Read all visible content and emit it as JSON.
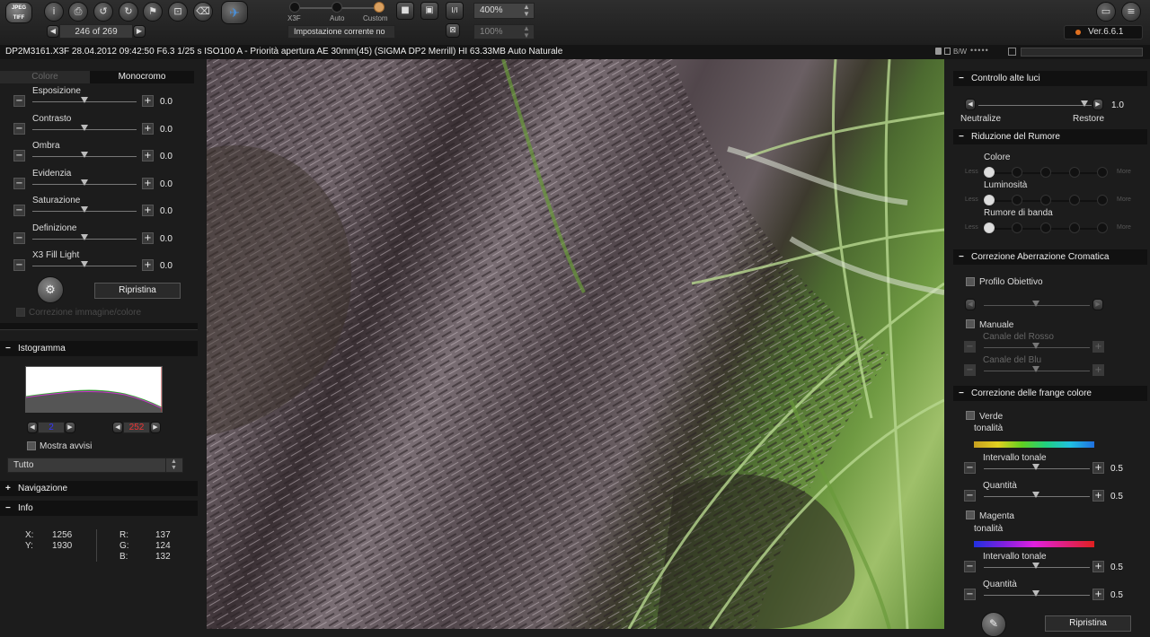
{
  "toolbar": {
    "file_format_icon_text": "JPEG TIFF",
    "nav_counter": "246 of 269",
    "mode_labels": [
      "X3F",
      "Auto",
      "Custom"
    ],
    "current_setting": "Impostazione corrente no",
    "zoom_primary": "400%",
    "zoom_secondary": "100%",
    "version": "Ver.6.6.1"
  },
  "infobar": {
    "text": "DP2M3161.X3F  28.04.2012 09:42:50  F6.3 1/25 s ISO100 A - Priorità apertura AE 30mm(45) (SIGMA DP2 Merrill) HI 63.33MB Auto Naturale",
    "bw_label": "B/W"
  },
  "left_panel": {
    "tabs": [
      "Colore",
      "Monocromo"
    ],
    "sliders": [
      {
        "label": "Esposizione",
        "value": "0.0"
      },
      {
        "label": "Contrasto",
        "value": "0.0"
      },
      {
        "label": "Ombra",
        "value": "0.0"
      },
      {
        "label": "Evidenzia",
        "value": "0.0"
      },
      {
        "label": "Saturazione",
        "value": "0.0"
      },
      {
        "label": "Definizione",
        "value": "0.0"
      },
      {
        "label": "X3 Fill Light",
        "value": "0.0"
      }
    ],
    "reset_label": "Ripristina",
    "faded_option": "Correzione immagine/colore",
    "histogram": {
      "title": "Istogramma",
      "low_value": "2",
      "high_value": "252",
      "warnings_label": "Mostra avvisi",
      "channel": "Tutto"
    },
    "navigation_title": "Navigazione",
    "info": {
      "title": "Info",
      "x_label": "X:",
      "x": "1256",
      "y_label": "Y:",
      "y": "1930",
      "r_label": "R:",
      "r": "137",
      "g_label": "G:",
      "g": "124",
      "b_label": "B:",
      "b": "132"
    }
  },
  "right_panel": {
    "highlight": {
      "title": "Controllo alte luci",
      "value": "1.0",
      "left_label": "Neutralize",
      "right_label": "Restore"
    },
    "noise": {
      "title": "Riduzione del Rumore",
      "rows": [
        {
          "label": "Colore",
          "level": 0
        },
        {
          "label": "Luminosità",
          "level": 0
        },
        {
          "label": "Rumore di banda",
          "level": 0
        }
      ],
      "less": "Less",
      "more": "More"
    },
    "chromatic": {
      "title": "Correzione Aberrazione Cromatica",
      "lens_profile": "Profilo Obiettivo",
      "manual": "Manuale",
      "red_channel": "Canale del Rosso",
      "blue_channel": "Canale del Blu"
    },
    "fringe": {
      "title": "Correzione delle frange colore",
      "green": "Verde",
      "magenta": "Magenta",
      "hue": "tonalità",
      "tonal_range": "Intervallo tonale",
      "amount": "Quantità",
      "green_range_value": "0.5",
      "green_amount_value": "0.5",
      "magenta_range_value": "0.5",
      "magenta_amount_value": "0.5"
    },
    "reset_label": "Ripristina"
  },
  "colors": {
    "background": "#1c1c1c",
    "section_header": "#111111",
    "accent_version_dot": "#e07020"
  }
}
